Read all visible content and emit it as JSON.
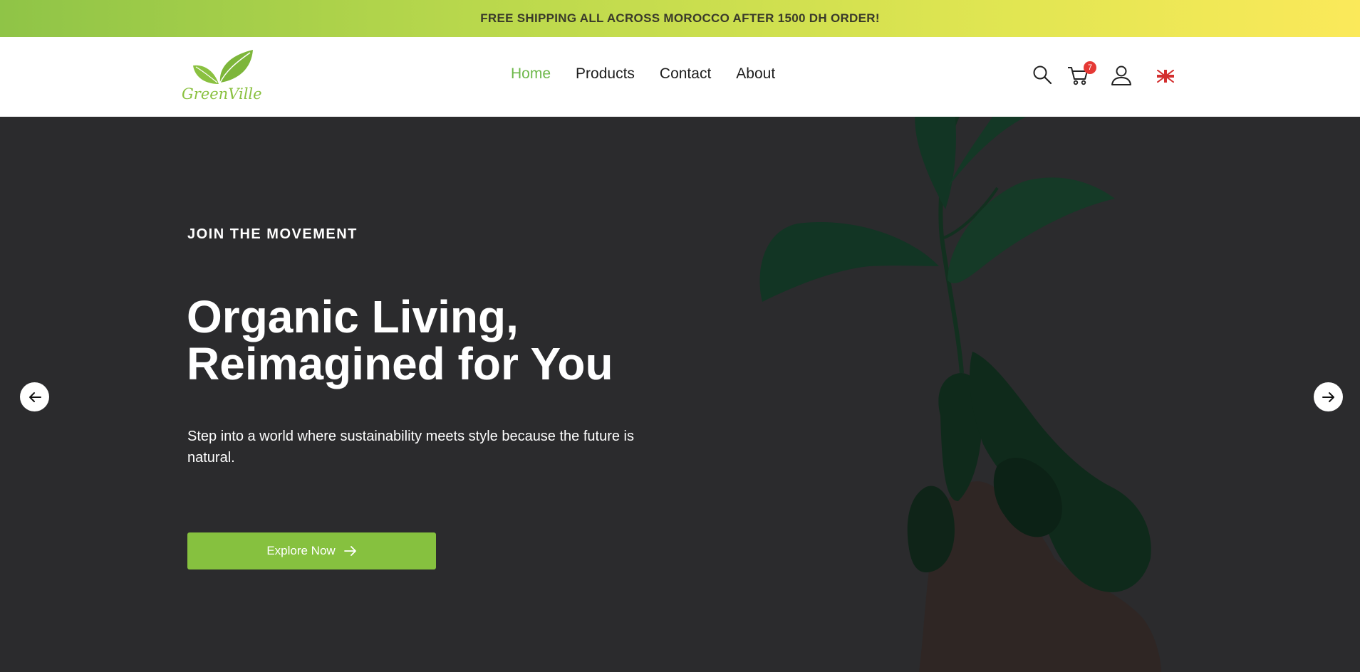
{
  "promo": {
    "text": "FREE SHIPPING ALL ACROSS MOROCCO AFTER 1500 DH ORDER!"
  },
  "header": {
    "logo_text": "GreenVille",
    "nav": [
      {
        "label": "Home",
        "active": true
      },
      {
        "label": "Products",
        "active": false
      },
      {
        "label": "Contact",
        "active": false
      },
      {
        "label": "About",
        "active": false
      }
    ],
    "cart_count": "7",
    "icons": [
      "search-icon",
      "cart-icon",
      "user-icon",
      "uk-flag-icon"
    ]
  },
  "hero": {
    "eyebrow": "JOIN THE MOVEMENT",
    "headline_line1": "Organic Living,",
    "headline_line2": "Reimagined for You",
    "subtext": "Step into a world where sustainability meets style because the future is natural.",
    "cta_label": "Explore Now"
  },
  "colors": {
    "accent": "#86c13f",
    "nav_active": "#6db84a",
    "hero_bg": "#2b2b2d",
    "badge": "#e53935"
  }
}
